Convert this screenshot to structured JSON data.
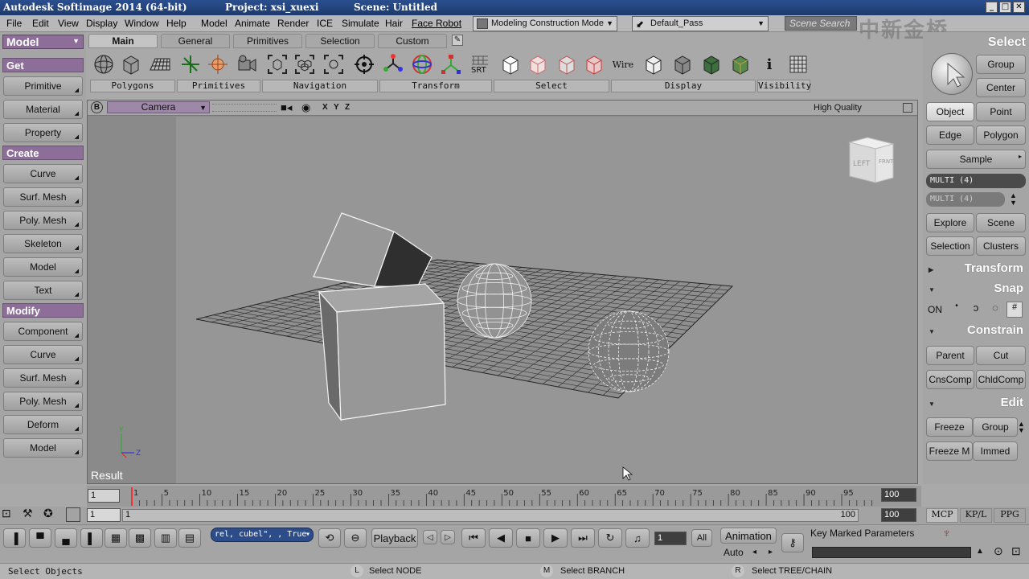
{
  "titlebar": {
    "app": "Autodesk Softimage 2014 (64-bit)",
    "project": "Project: xsi_xuexi",
    "scene": "Scene: Untitled"
  },
  "menubar": {
    "items": [
      "File",
      "Edit",
      "View",
      "Display",
      "Window",
      "Help",
      "Model",
      "Animate",
      "Render",
      "ICE",
      "Simulate",
      "Hair",
      "Face Robot"
    ],
    "mode": "Modeling Construction Mode",
    "pass": "Default_Pass",
    "search_placeholder": "Scene Search",
    "watermark": "中新金桥"
  },
  "leftpanel": {
    "module": "Model",
    "get_header": "Get",
    "get_items": [
      "Primitive",
      "Material",
      "Property"
    ],
    "create_header": "Create",
    "create_items": [
      "Curve",
      "Surf. Mesh",
      "Poly. Mesh",
      "Skeleton",
      "Model",
      "Text"
    ],
    "modify_header": "Modify",
    "modify_items": [
      "Component",
      "Curve",
      "Surf. Mesh",
      "Poly. Mesh",
      "Deform",
      "Model"
    ]
  },
  "toolbar": {
    "tabs": [
      "Main",
      "General",
      "Primitives",
      "Selection",
      "Custom"
    ],
    "groups": [
      "Polygons",
      "Primitives",
      "Navigation",
      "Transform",
      "Select",
      "Display",
      "Visibility"
    ],
    "srt_label": "SRT",
    "wire_label": "Wire",
    "info_label": "i"
  },
  "viewport": {
    "badge": "B",
    "camera": "Camera",
    "axes": [
      "X",
      "Y",
      "Z"
    ],
    "quality": "High Quality",
    "result_label": "Result",
    "viewcube_left": "LEFT",
    "viewcube_front": "FRNT"
  },
  "rightpanel": {
    "title": "Select",
    "group": "Group",
    "center": "Center",
    "object": "Object",
    "point": "Point",
    "edge": "Edge",
    "polygon": "Polygon",
    "sample": "Sample",
    "multi1": "MULTI (4)",
    "multi2": "MULTI (4)",
    "explore": "Explore",
    "scene": "Scene",
    "selection": "Selection",
    "clusters": "Clusters",
    "transform": "Transform",
    "snap": "Snap",
    "snap_on": "ON",
    "constrain": "Constrain",
    "parent": "Parent",
    "cut": "Cut",
    "cnscomp": "CnsComp",
    "chldcomp": "ChldComp",
    "edit": "Edit",
    "freeze": "Freeze",
    "group2": "Group",
    "freezem": "Freeze M",
    "immed": "Immed",
    "bottom_tabs": [
      "MCP",
      "KP/L",
      "PPG"
    ]
  },
  "timeline": {
    "start": "1",
    "end": "100",
    "ticks": [
      "1",
      "5",
      "10",
      "15",
      "20",
      "25",
      "30",
      "35",
      "40",
      "45",
      "50",
      "55",
      "60",
      "65",
      "70",
      "75",
      "80",
      "85",
      "90",
      "95"
    ],
    "range_start": "1",
    "range_label": "1",
    "range_end_label": "100",
    "range_end": "100"
  },
  "playbar": {
    "cmd_text": "rel, cubel\", , True",
    "playback": "Playback",
    "frame": "1",
    "all": "All",
    "animation": "Animation",
    "auto": "Auto",
    "key_marked": "Key Marked Parameters"
  },
  "statusbar": {
    "left": "Select Objects",
    "l_key": "L",
    "l_text": "Select NODE",
    "m_key": "M",
    "m_text": "Select BRANCH",
    "r_key": "R",
    "r_text": "Select TREE/CHAIN"
  }
}
